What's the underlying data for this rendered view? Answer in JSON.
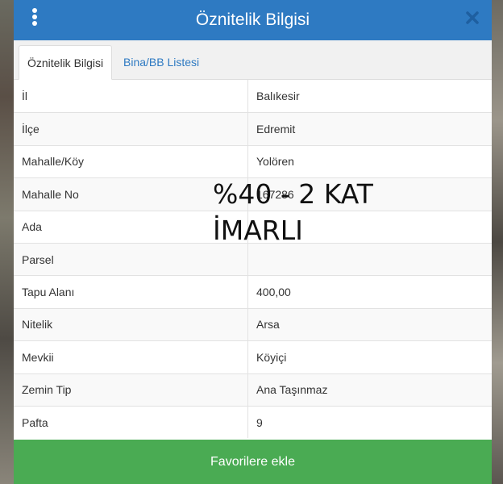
{
  "header": {
    "title": "Öznitelik Bilgisi",
    "menu_icon": "kebab-menu-icon",
    "close_icon": "close-icon"
  },
  "tabs": [
    {
      "label": "Öznitelik Bilgisi",
      "active": true
    },
    {
      "label": "Bina/BB Listesi",
      "active": false
    }
  ],
  "rows": [
    {
      "label": "İl",
      "value": "Balıkesir"
    },
    {
      "label": "İlçe",
      "value": "Edremit"
    },
    {
      "label": "Mahalle/Köy",
      "value": "Yolören"
    },
    {
      "label": "Mahalle No",
      "value": "167286"
    },
    {
      "label": "Ada",
      "value": ""
    },
    {
      "label": "Parsel",
      "value": ""
    },
    {
      "label": "Tapu Alanı",
      "value": "400,00"
    },
    {
      "label": "Nitelik",
      "value": "Arsa"
    },
    {
      "label": "Mevkii",
      "value": "Köyiçi"
    },
    {
      "label": "Zemin Tip",
      "value": "Ana Taşınmaz"
    },
    {
      "label": "Pafta",
      "value": "9"
    }
  ],
  "overlay": {
    "line1": "%40 - 2 KAT",
    "line2": "İMARLI"
  },
  "footer": {
    "favorite_label": "Favorilere ekle"
  },
  "colors": {
    "header": "#2e7ac2",
    "favorite_button": "#4aab53",
    "tab_link": "#2e7ac2"
  }
}
